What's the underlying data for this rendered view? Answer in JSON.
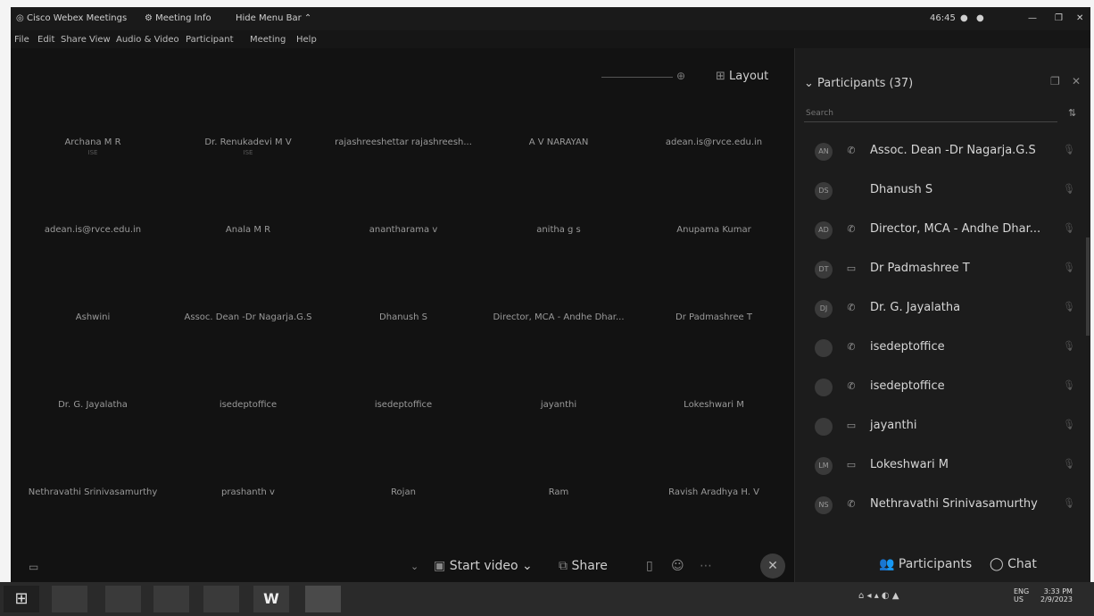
{
  "titlebar": {
    "app_name": "Cisco Webex Meetings",
    "meeting_info": "Meeting Info",
    "hide_menu": "Hide Menu Bar",
    "timer": "46:45"
  },
  "menu": [
    "File",
    "Edit",
    "Share",
    "View",
    "Audio & Video",
    "Participant",
    "Meeting",
    "Help"
  ],
  "stage": {
    "layout_label": "Layout",
    "tiles": [
      {
        "name": "Archana M R",
        "sub": "ISE"
      },
      {
        "name": "Dr. Renukadevi M V",
        "sub": "ISE"
      },
      {
        "name": "rajashreeshettar rajashreesh...",
        "sub": ""
      },
      {
        "name": "A V NARAYAN",
        "sub": ""
      },
      {
        "name": "adean.is@rvce.edu.in",
        "sub": ""
      },
      {
        "name": "adean.is@rvce.edu.in",
        "sub": ""
      },
      {
        "name": "Anala M R",
        "sub": ""
      },
      {
        "name": "anantharama v",
        "sub": ""
      },
      {
        "name": "anitha g s",
        "sub": ""
      },
      {
        "name": "Anupama Kumar",
        "sub": ""
      },
      {
        "name": "Ashwini",
        "sub": ""
      },
      {
        "name": "Assoc. Dean -Dr Nagarja.G.S",
        "sub": ""
      },
      {
        "name": "Dhanush S",
        "sub": ""
      },
      {
        "name": "Director, MCA - Andhe Dhar...",
        "sub": ""
      },
      {
        "name": "Dr Padmashree T",
        "sub": ""
      },
      {
        "name": "Dr. G. Jayalatha",
        "sub": ""
      },
      {
        "name": "isedeptoffice",
        "sub": ""
      },
      {
        "name": "isedeptoffice",
        "sub": ""
      },
      {
        "name": "jayanthi",
        "sub": ""
      },
      {
        "name": "Lokeshwari M",
        "sub": ""
      },
      {
        "name": "Nethravathi Srinivasamurthy",
        "sub": ""
      },
      {
        "name": "prashanth v",
        "sub": ""
      },
      {
        "name": "Rojan",
        "sub": ""
      },
      {
        "name": "Ram",
        "sub": ""
      },
      {
        "name": "Ravish Aradhya H. V",
        "sub": ""
      }
    ]
  },
  "controls": {
    "start_video": "Start video",
    "share": "Share",
    "participants": "Participants",
    "chat": "Chat"
  },
  "panel": {
    "title": "Participants (37)",
    "search_placeholder": "Search",
    "participants": [
      {
        "initials": "AN",
        "name": "Assoc. Dean -Dr Nagarja.G.S",
        "icon": "phone-icon"
      },
      {
        "initials": "DS",
        "name": "Dhanush S",
        "icon": ""
      },
      {
        "initials": "AD",
        "name": "Director, MCA - Andhe Dhar...",
        "icon": "phone-icon"
      },
      {
        "initials": "DT",
        "name": "Dr Padmashree T",
        "icon": "computer-icon"
      },
      {
        "initials": "DJ",
        "name": "Dr. G. Jayalatha",
        "icon": "phone-icon"
      },
      {
        "initials": "",
        "name": "isedeptoffice",
        "icon": "phone-icon"
      },
      {
        "initials": "",
        "name": "isedeptoffice",
        "icon": "phone-icon"
      },
      {
        "initials": "",
        "name": "jayanthi",
        "icon": "computer-icon"
      },
      {
        "initials": "LM",
        "name": "Lokeshwari M",
        "icon": "computer-icon"
      },
      {
        "initials": "NS",
        "name": "Nethravathi Srinivasamurthy",
        "icon": "phone-icon"
      }
    ]
  },
  "taskbar": {
    "lang": "ENG",
    "region": "US",
    "time": "3:33 PM",
    "date": "2/9/2023"
  }
}
